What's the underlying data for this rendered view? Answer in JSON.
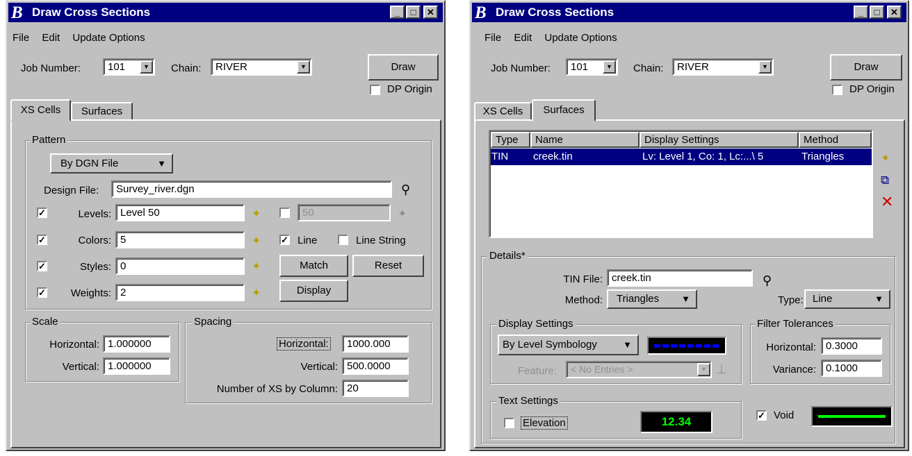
{
  "left": {
    "title": "Draw Cross Sections",
    "menu": [
      "File",
      "Edit",
      "Update Options"
    ],
    "job_label": "Job Number:",
    "job_value": "101",
    "chain_label": "Chain:",
    "chain_value": "RIVER",
    "draw_label": "Draw",
    "dp_origin_label": "DP Origin",
    "tabs": [
      "XS Cells",
      "Surfaces"
    ],
    "pattern": {
      "title": "Pattern",
      "mode": "By DGN File",
      "design_file_label": "Design File:",
      "design_file_value": "Survey_river.dgn",
      "levels_label": "Levels:",
      "levels_value": "Level 50",
      "levels_alt_value": "50",
      "colors_label": "Colors:",
      "colors_value": "5",
      "line_label": "Line",
      "line_string_label": "Line String",
      "styles_label": "Styles:",
      "styles_value": "0",
      "match_label": "Match",
      "reset_label": "Reset",
      "weights_label": "Weights:",
      "weights_value": "2",
      "display_label": "Display"
    },
    "scale": {
      "title": "Scale",
      "horizontal_label": "Horizontal:",
      "horizontal_value": "1.000000",
      "vertical_label": "Vertical:",
      "vertical_value": "1.000000"
    },
    "spacing": {
      "title": "Spacing",
      "horizontal_label": "Horizontal:",
      "horizontal_value": "1000.000",
      "vertical_label": "Vertical:",
      "vertical_value": "500.0000",
      "num_label": "Number of XS by Column:",
      "num_value": "20"
    }
  },
  "right": {
    "title": "Draw Cross Sections",
    "menu": [
      "File",
      "Edit",
      "Update Options"
    ],
    "job_label": "Job Number:",
    "job_value": "101",
    "chain_label": "Chain:",
    "chain_value": "RIVER",
    "draw_label": "Draw",
    "dp_origin_label": "DP Origin",
    "tabs": [
      "XS Cells",
      "Surfaces"
    ],
    "table": {
      "headers": [
        "Type",
        "Name",
        "Display Settings",
        "Method"
      ],
      "rows": [
        [
          "TIN",
          "creek.tin",
          "Lv: Level 1, Co: 1, Lc:...\\ 5",
          "Triangles"
        ]
      ]
    },
    "details": {
      "title": "Details*",
      "tin_file_label": "TIN File:",
      "tin_file_value": "creek.tin",
      "method_label": "Method:",
      "method_value": "Triangles",
      "type_label": "Type:",
      "type_value": "Line"
    },
    "display_settings": {
      "title": "Display Settings",
      "mode": "By Level Symbology",
      "feature_label": "Feature:",
      "feature_value": "< No Entries >"
    },
    "filter": {
      "title": "Filter Tolerances",
      "horizontal_label": "Horizontal:",
      "horizontal_value": "0.3000",
      "variance_label": "Variance:",
      "variance_value": "0.1000"
    },
    "text_settings": {
      "title": "Text Settings",
      "elevation_label": "Elevation",
      "preview_text": "12.34"
    },
    "void_label": "Void",
    "colors": {
      "title_bar": "#000080",
      "symbology": "#0000ff",
      "void_line": "#00ff00",
      "preview_text": "#00ff00"
    }
  }
}
